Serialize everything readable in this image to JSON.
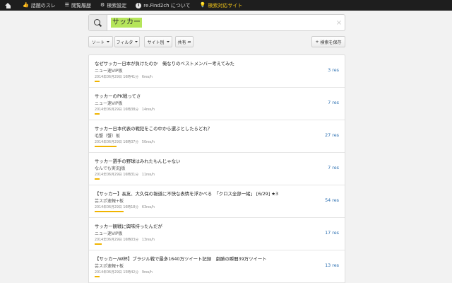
{
  "nav": {
    "items": [
      {
        "label": "",
        "icon": "home-icon"
      },
      {
        "label": "話題のスレ",
        "icon": "thumbs-up-icon"
      },
      {
        "label": "閲覧履歴",
        "icon": "list-icon"
      },
      {
        "label": "検索設定",
        "icon": "gear-icon"
      },
      {
        "label": "re.Find2ch について",
        "icon": "info-icon"
      },
      {
        "label": "検索対応サイト",
        "icon": "lightbulb-icon"
      }
    ],
    "accent_color": "#f0c419"
  },
  "search": {
    "value": "サッカー",
    "clear_glyph": "×",
    "highlight_color": "#b5e55a"
  },
  "toolbar": {
    "sort_label": "ソート",
    "filter_label": "フィルタ",
    "site_label": "サイト別",
    "share_label": "共有",
    "save_label": "検索を保存"
  },
  "threads": [
    {
      "title": "なぜサッカー日本が負けたのか　俺なりのベストメンバー考えてみた",
      "board": "ニュー速VIP板",
      "meta": "2014年06月29日 16時41分　6res/h",
      "res": "3 res",
      "bar": 0.02
    },
    {
      "title": "サッカーのPK戦ってさ",
      "board": "ニュー速VIP板",
      "meta": "2014年06月29日 16時38分　14res/h",
      "res": "7 res",
      "bar": 0.02
    },
    {
      "title": "サッカー日本代表の戦犯をこの中から選ぶとしたらどれ？",
      "board": "毛蟹（蟹）板",
      "meta": "2014年06月29日 16時37分　50res/h",
      "res": "27 res",
      "bar": 0.09
    },
    {
      "title": "サッカー選手の野球はみれたもんじゃない",
      "board": "なんでも実況J板",
      "meta": "2014年06月29日 16時31分　11res/h",
      "res": "7 res",
      "bar": 0.02
    },
    {
      "title": "【サッカー】長友、大久保の報道に不快な表情を浮かべる　「クロス全部一緒」 [6/29] ★3",
      "board": "芸スポ速報+板",
      "meta": "2014年06月29日 16時18分　63res/h",
      "res": "54 res",
      "bar": 0.12
    },
    {
      "title": "サッカー観戦に興味持ったんだが",
      "board": "ニュー速VIP板",
      "meta": "2014年06月29日 16時03分　13res/h",
      "res": "17 res",
      "bar": 0.03
    },
    {
      "title": "【サッカー/W杯】ブラジル戦で最多1640万ツイート記録　劇勝の瞬間39万ツイート",
      "board": "芸スポ速報+板",
      "meta": "2014年06月29日 15時42分　9res/h",
      "res": "13 res",
      "bar": 0.02
    }
  ]
}
